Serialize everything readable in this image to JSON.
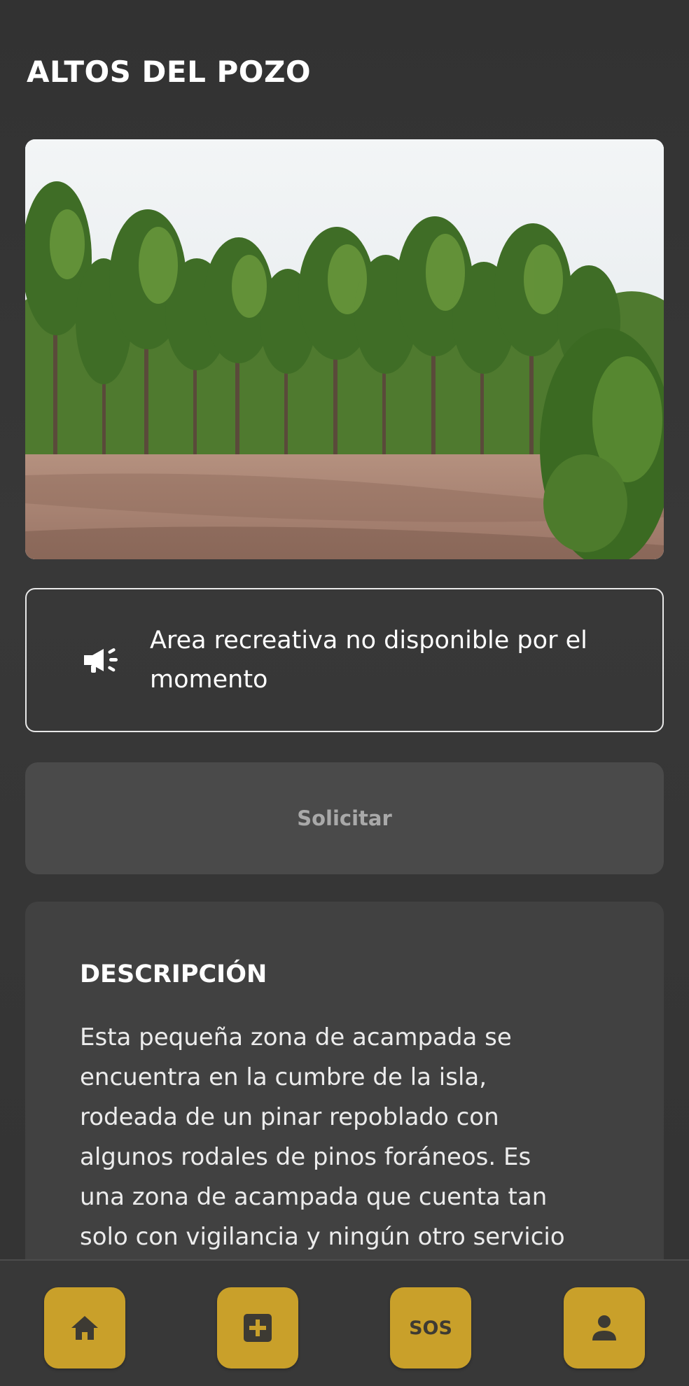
{
  "header": {
    "title": "ALTOS DEL POZO"
  },
  "hero": {
    "image": "pine-forest-clearing"
  },
  "notice": {
    "icon": "megaphone-icon",
    "text": "Area recreativa no disponible por el momento"
  },
  "actions": {
    "request_label": "Solicitar",
    "request_enabled": false
  },
  "description": {
    "title": "DESCRIPCIÓN",
    "lines": [
      "Esta pequeña zona de acampada se",
      "encuentra en la cumbre de la isla,",
      "rodeada de un pinar repoblado con",
      "algunos rodales de pinos foráneos. Es",
      "una zona de acampada que cuenta tan",
      "solo con vigilancia y ningún otro servicio"
    ]
  },
  "bottom_nav": {
    "items": [
      {
        "icon": "home-icon"
      },
      {
        "icon": "plus-square-icon"
      },
      {
        "icon": "sos-icon",
        "label": "SOS"
      },
      {
        "icon": "user-icon"
      }
    ]
  },
  "colors": {
    "background": "#353535",
    "accent": "#c9a02a",
    "button_disabled": "#4a4a4a",
    "card": "#414141"
  }
}
